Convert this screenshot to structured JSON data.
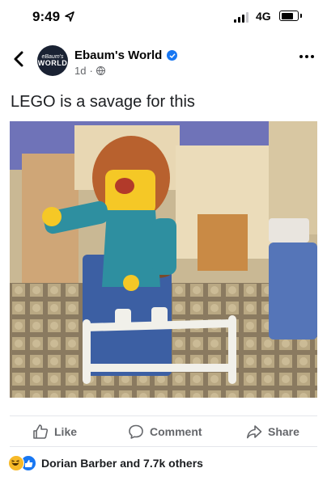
{
  "status_bar": {
    "time": "9:49",
    "network": "4G",
    "signal_bars": 3,
    "battery_level": 0.85
  },
  "post": {
    "page_name": "Ebaum's World",
    "avatar_text_top": "eBaum's",
    "avatar_text_bottom": "WORLD",
    "age": "1d",
    "separator": "·",
    "caption": "LEGO is a savage for this"
  },
  "actions": {
    "like": "Like",
    "comment": "Comment",
    "share": "Share"
  },
  "reactions": {
    "summary": "Dorian Barber and 7.7k others"
  },
  "colors": {
    "accent": "#1877f2",
    "muted": "#65676b",
    "haha": "#f7b928"
  },
  "icons": [
    "location-arrow-icon",
    "back-chevron-icon",
    "verified-badge-icon",
    "globe-icon",
    "more-options-icon",
    "like-icon",
    "comment-icon",
    "share-icon",
    "haha-reaction-icon",
    "like-reaction-icon"
  ]
}
